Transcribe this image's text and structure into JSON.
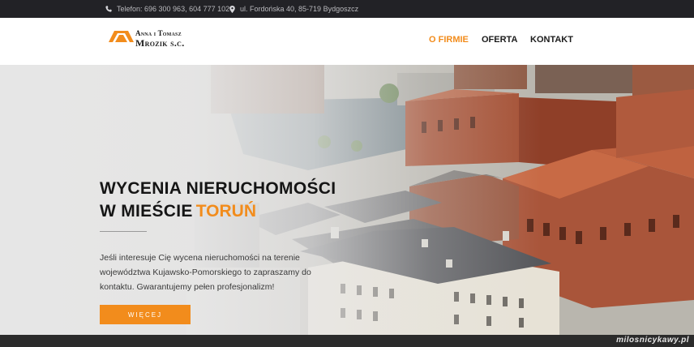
{
  "topbar": {
    "phone": "Telefon: 696 300 963, 604 777 102",
    "address": "ul. Fordońska 40, 85-719 Bydgoszcz"
  },
  "logo": {
    "line1": "Anna i Tomasz",
    "line2": "Mrozik s.c."
  },
  "nav": {
    "items": [
      {
        "label": "O FIRMIE",
        "active": true
      },
      {
        "label": "OFERTA",
        "active": false
      },
      {
        "label": "KONTAKT",
        "active": false
      }
    ]
  },
  "hero": {
    "heading_line1": "WYCENIA NIERUCHOMOŚCI",
    "heading_line2": "W MIEŚCIE",
    "city": "TORUŃ",
    "text": "Jeśli interesuje Cię wycena nieruchomości na terenie województwa Kujawsko-Pomorskiego to zapraszamy do kontaktu. Gwarantujemy pełen profesjonalizm!",
    "button": "WIĘCEJ"
  },
  "watermark": "milosnicykawy.pl",
  "colors": {
    "accent": "#f28c1c",
    "topbar": "#222226",
    "text": "#151515"
  }
}
